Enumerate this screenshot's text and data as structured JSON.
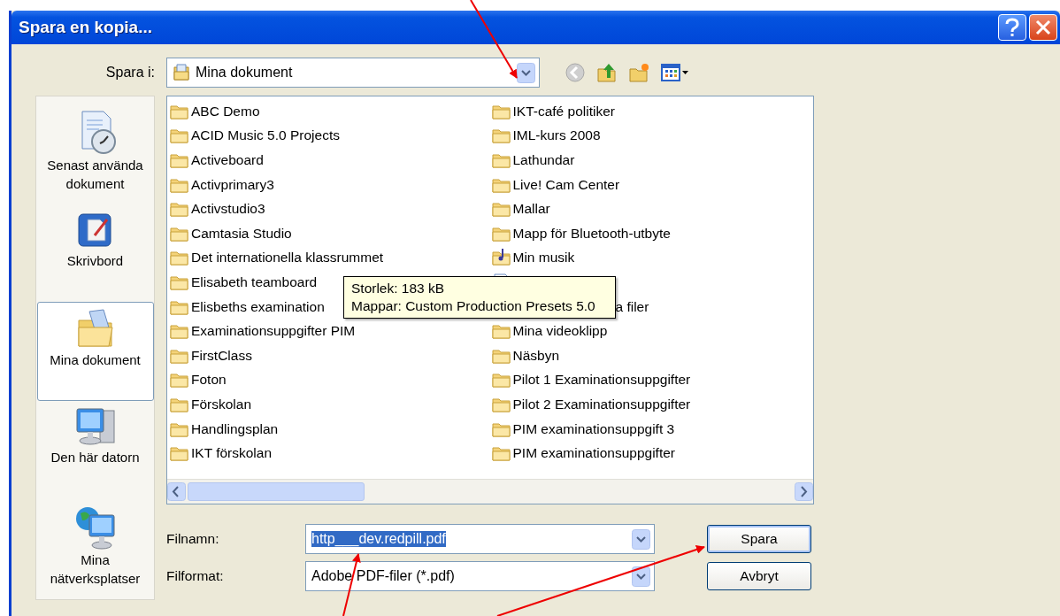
{
  "window": {
    "title": "Spara en kopia..."
  },
  "save_in": {
    "label": "Spara i:",
    "value": "Mina dokument"
  },
  "sidebar": {
    "items": [
      {
        "label": "Senast använda dokument",
        "kind": "recent",
        "selected": false
      },
      {
        "label": "Skrivbord",
        "kind": "desktop",
        "selected": false
      },
      {
        "label": "Mina dokument",
        "kind": "documents",
        "selected": true
      },
      {
        "label": "Den här datorn",
        "kind": "computer",
        "selected": false
      },
      {
        "label": "Mina nätverksplatser",
        "kind": "network",
        "selected": false
      }
    ]
  },
  "files": {
    "columns": [
      [
        {
          "label": "ABC Demo",
          "kind": "folder"
        },
        {
          "label": "ACID Music 5.0 Projects",
          "kind": "folder"
        },
        {
          "label": "Activeboard",
          "kind": "folder"
        },
        {
          "label": "Activprimary3",
          "kind": "folder"
        },
        {
          "label": "Activstudio3",
          "kind": "folder"
        },
        {
          "label": "Camtasia Studio",
          "kind": "folder"
        },
        {
          "label": "Det internationella klassrummet",
          "kind": "folder"
        },
        {
          "label": "Elisabeth teamboard",
          "kind": "folder"
        },
        {
          "label": "Elisbeths examination",
          "kind": "folder"
        },
        {
          "label": "Examinationsuppgifter PIM",
          "kind": "folder"
        },
        {
          "label": "FirstClass",
          "kind": "folder"
        },
        {
          "label": "Foton",
          "kind": "folder"
        },
        {
          "label": "Förskolan",
          "kind": "folder"
        },
        {
          "label": "Handlingsplan",
          "kind": "folder"
        },
        {
          "label": "IKT förskolan",
          "kind": "folder"
        }
      ],
      [
        {
          "label": "IKT-café politiker",
          "kind": "folder"
        },
        {
          "label": "IML-kurs 2008",
          "kind": "folder"
        },
        {
          "label": "Lathundar",
          "kind": "folder"
        },
        {
          "label": "Live! Cam Center",
          "kind": "folder"
        },
        {
          "label": "Mallar",
          "kind": "folder"
        },
        {
          "label": "Mapp för Bluetooth-utbyte",
          "kind": "folder"
        },
        {
          "label": "Min musik",
          "kind": "music"
        },
        {
          "kind": "document"
        },
        {
          "label": "a filer",
          "kind": "covered"
        },
        {
          "label": "Mina videoklipp",
          "kind": "folder"
        },
        {
          "label": "Näsbyn",
          "kind": "folder"
        },
        {
          "label": "Pilot 1 Examinationsuppgifter",
          "kind": "folder"
        },
        {
          "label": "Pilot 2 Examinationsuppgifter",
          "kind": "folder"
        },
        {
          "label": "PIM examinationsuppgift 3",
          "kind": "folder"
        },
        {
          "label": "PIM examinationsuppgifter",
          "kind": "folder"
        }
      ]
    ]
  },
  "tooltip": {
    "lines": [
      "Storlek: 183 kB",
      "Mappar: Custom Production Presets 5.0"
    ]
  },
  "file_name": {
    "label": "Filnamn:",
    "value": "http___dev.redpill.pdf",
    "text_selected": true
  },
  "file_format": {
    "label": "Filformat:",
    "value": "Adobe PDF-filer (*.pdf)"
  },
  "buttons": [
    {
      "label": "Spara",
      "kind": "default"
    },
    {
      "label": "Avbryt",
      "kind": "normal"
    }
  ]
}
